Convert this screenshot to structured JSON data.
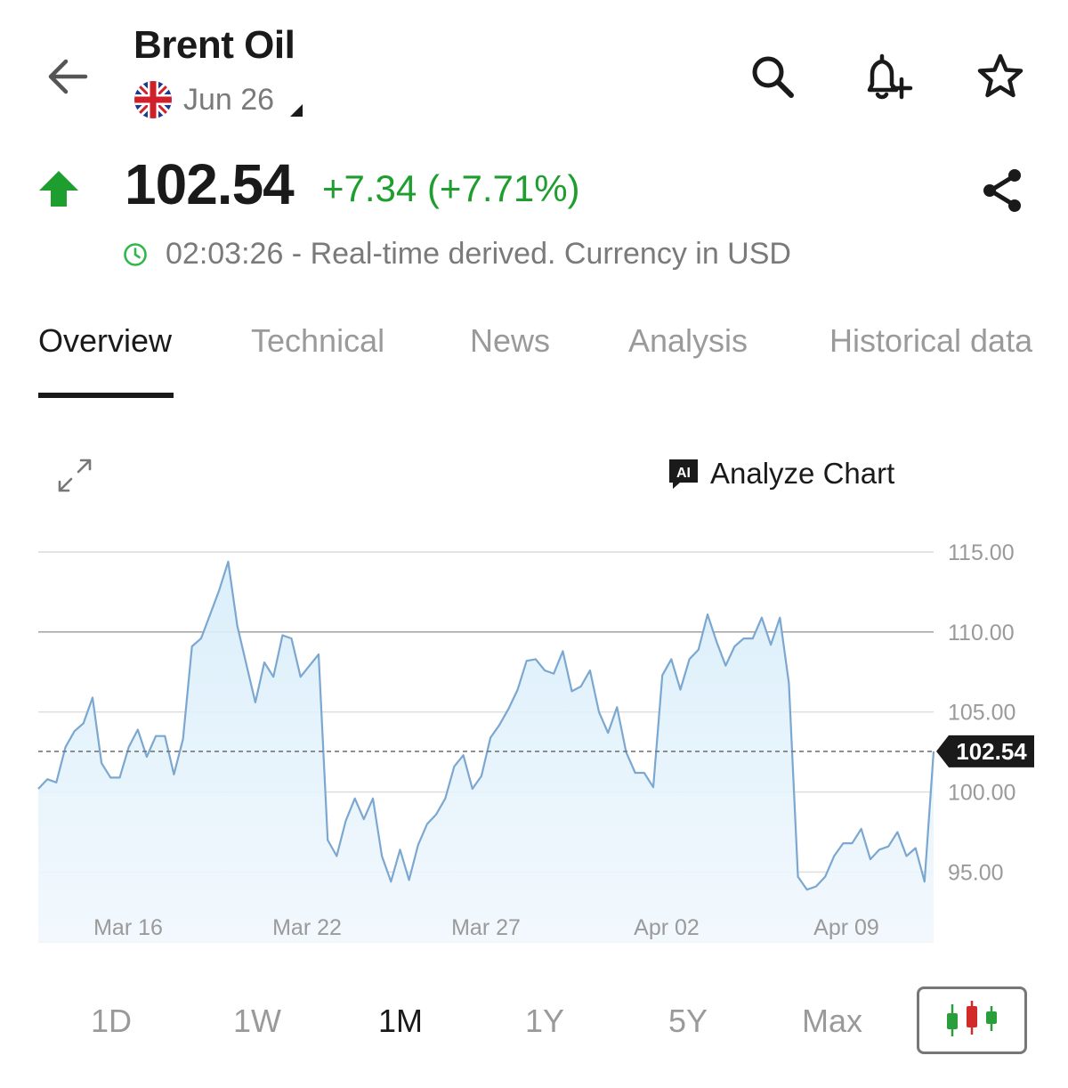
{
  "header": {
    "title": "Brent Oil",
    "contract_label": "Jun 26"
  },
  "quote": {
    "price": "102.54",
    "change": "+7.34 (+7.71%)",
    "status_time": "02:03:26",
    "status_text": "02:03:26 - Real-time derived. Currency in USD",
    "up_color": "#1e9e2e"
  },
  "tabs": [
    {
      "label": "Overview",
      "active": true
    },
    {
      "label": "Technical",
      "active": false
    },
    {
      "label": "News",
      "active": false
    },
    {
      "label": "Analysis",
      "active": false
    },
    {
      "label": "Historical data",
      "active": false
    }
  ],
  "chart_toolbar": {
    "ai_badge": "AI",
    "analyze_label": "Analyze Chart"
  },
  "chart_data": {
    "type": "area",
    "y_ticks": [
      "115.00",
      "110.00",
      "105.00",
      "100.00",
      "95.00"
    ],
    "x_ticks": [
      "Mar 16",
      "Mar 22",
      "Mar 27",
      "Apr 02",
      "Apr 09"
    ],
    "ylim": [
      93.3,
      115.0
    ],
    "current_value": 102.54,
    "current_label": "102.54",
    "line_color": "#7ba7d0",
    "values": [
      100.2,
      100.8,
      100.6,
      102.8,
      103.8,
      104.3,
      105.9,
      101.8,
      100.9,
      100.9,
      102.8,
      103.9,
      102.2,
      103.5,
      103.5,
      101.1,
      103.3,
      109.1,
      109.6,
      111.1,
      112.6,
      114.4,
      110.4,
      108.0,
      105.6,
      108.1,
      107.2,
      109.8,
      109.6,
      107.2,
      107.9,
      108.6,
      97.0,
      96.0,
      98.2,
      99.6,
      98.3,
      99.6,
      96.0,
      94.4,
      96.4,
      94.5,
      96.7,
      98.0,
      98.6,
      99.6,
      101.6,
      102.3,
      100.2,
      101.0,
      103.4,
      104.2,
      105.2,
      106.4,
      108.2,
      108.3,
      107.6,
      107.4,
      108.8,
      106.3,
      106.6,
      107.6,
      105.0,
      103.7,
      105.3,
      102.5,
      101.2,
      101.2,
      100.3,
      107.3,
      108.3,
      106.4,
      108.3,
      108.9,
      111.1,
      109.4,
      107.9,
      109.1,
      109.6,
      109.6,
      110.9,
      109.2,
      110.9,
      106.8,
      94.7,
      93.9,
      94.1,
      94.7,
      96.0,
      96.8,
      96.8,
      97.7,
      95.8,
      96.4,
      96.6,
      97.5,
      96.0,
      96.5,
      94.4,
      102.54
    ]
  },
  "ranges": [
    {
      "label": "1D",
      "active": false
    },
    {
      "label": "1W",
      "active": false
    },
    {
      "label": "1M",
      "active": true
    },
    {
      "label": "1Y",
      "active": false
    },
    {
      "label": "5Y",
      "active": false
    },
    {
      "label": "Max",
      "active": false
    }
  ],
  "icons": {
    "back": "arrow-left-icon",
    "flag": "uk-flag-icon",
    "search": "search-icon",
    "alert": "bell-plus-icon",
    "watchlist": "star-icon",
    "share": "share-icon",
    "expand": "expand-icon",
    "candles": "candlestick-icon"
  }
}
